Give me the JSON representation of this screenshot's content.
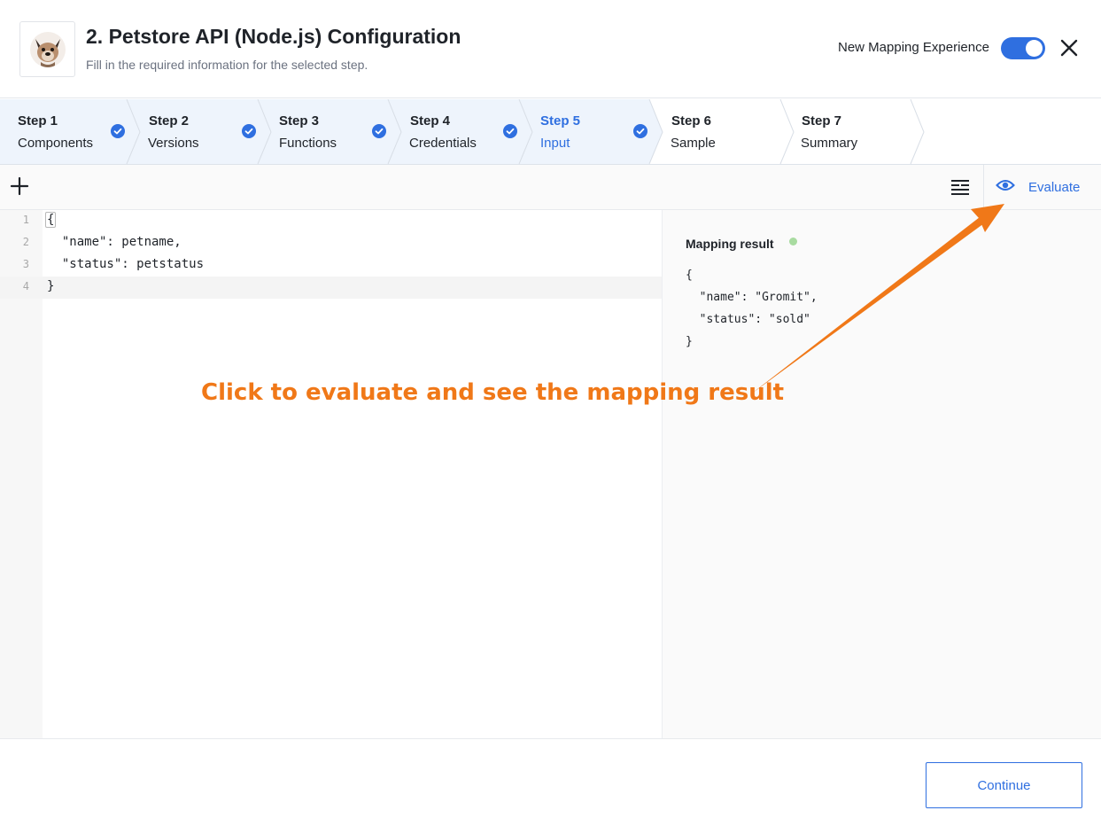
{
  "header": {
    "title": "2. Petstore API (Node.js) Configuration",
    "subtitle": "Fill in the required information for the selected step.",
    "toggle_label": "New Mapping Experience",
    "toggle_on": true,
    "logo_icon": "dog-avatar-icon",
    "close_icon": "close-icon"
  },
  "steps": [
    {
      "num": "Step 1",
      "name": "Components",
      "done": true
    },
    {
      "num": "Step 2",
      "name": "Versions",
      "done": true
    },
    {
      "num": "Step 3",
      "name": "Functions",
      "done": true
    },
    {
      "num": "Step 4",
      "name": "Credentials",
      "done": true
    },
    {
      "num": "Step 5",
      "name": "Input",
      "done": true,
      "active": true
    },
    {
      "num": "Step 6",
      "name": "Sample",
      "done": false
    },
    {
      "num": "Step 7",
      "name": "Summary",
      "done": false
    }
  ],
  "toolbar": {
    "add_icon": "plus-icon",
    "format_icon": "format-lines-icon",
    "evaluate_label": "Evaluate",
    "evaluate_icon": "eye-icon"
  },
  "editor": {
    "lines": [
      {
        "n": "1",
        "code": "{"
      },
      {
        "n": "2",
        "code": "  \"name\": petname,"
      },
      {
        "n": "3",
        "code": "  \"status\": petstatus"
      },
      {
        "n": "4",
        "code": "}"
      }
    ]
  },
  "result": {
    "title": "Mapping result",
    "status_color": "#a8dba0",
    "lines": [
      "{",
      "  \"name\": \"Gromit\",",
      "  \"status\": \"sold\"",
      "}"
    ]
  },
  "annotation": {
    "text": "Click to evaluate and see the mapping result",
    "color": "#f07818"
  },
  "footer": {
    "continue_label": "Continue"
  },
  "colors": {
    "accent": "#2f6fe0",
    "completed_step_bg": "#eef4fc"
  }
}
